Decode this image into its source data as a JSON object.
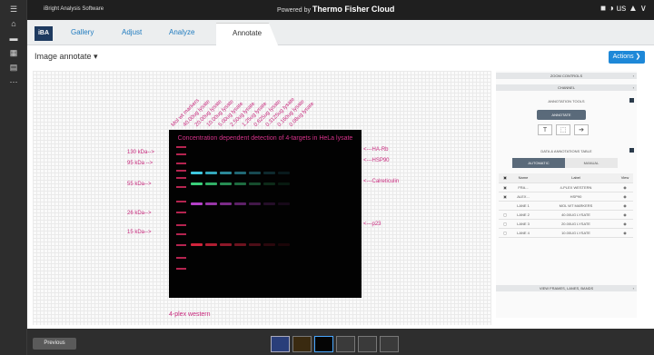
{
  "rail_icons": [
    "hamburger-icon",
    "home-icon",
    "folder-icon",
    "grid-icon",
    "document-icon",
    "more-icon"
  ],
  "topbar": {
    "app_name": "iBright Analysis Software",
    "powered_prefix": "Powered by",
    "powered_brand": "Thermo Fisher Cloud",
    "icons": "■  ◑ us  ▲ ∨"
  },
  "tabs": {
    "logo": "iBA",
    "gallery": "Gallery",
    "adjust": "Adjust",
    "analyze": "Analyze",
    "annotate": "Annotate"
  },
  "image": {
    "title": "Image annotate ▾",
    "actions": "Actions ❯"
  },
  "blot": {
    "title": "Concentration dependent detection of 4-targets in HeLa lysate",
    "lane_labels": [
      "Mol wt markers",
      "40.00ug lysate",
      "20.00ug lysate",
      "10.00ug lysate",
      "5.00ug lysate",
      "2.50ug lysate",
      "1.25ug lysate",
      "0.625ug lysate",
      "0.3125ug lysate",
      "0.160ug lysate",
      "0.08ug lysate"
    ],
    "mw_labels": [
      "130 kDa-->",
      "95 kDa -->",
      "55 kDa-->",
      "26 kDa-->",
      "15 kDa-->"
    ],
    "targets": [
      "<---HA-Rb",
      "<---HSP90",
      "<---Calreticulin",
      "<---p23"
    ],
    "caption": "4-plex western"
  },
  "panel": {
    "zoom": "ZOOM CONTROLS",
    "channel": "CHANNEL",
    "tools": "ANNOTATION TOOLS",
    "annotate_btn": "ANNOTATE",
    "data_table": "DATA & ANNOTATIONS TABLE",
    "automatic": "AUTOMATIC",
    "manual": "MANUAL",
    "headers": [
      "Name",
      "Label",
      "View"
    ],
    "rows": [
      [
        "FRA...",
        "4-PLEX WESTERN"
      ],
      [
        "ALEX...",
        "HSP90"
      ],
      [
        "LANE 1",
        "MOL WT MARKERS"
      ],
      [
        "LANE 2",
        "40.00UG LYSATE"
      ],
      [
        "LANE 3",
        "20.00UG LYSATE"
      ],
      [
        "LANE 4",
        "10.00UG LYSATE"
      ]
    ],
    "view_frames": "VIEW FRAMES, LANES, BANDS"
  },
  "bottom": {
    "previous": "Previous"
  }
}
